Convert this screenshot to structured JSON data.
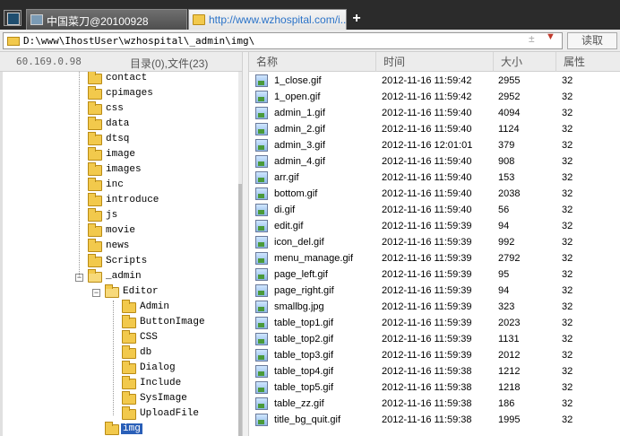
{
  "tabs": [
    {
      "label": "中国菜刀@20100928"
    },
    {
      "label": "http://www.wzhospital.com/i..."
    }
  ],
  "new_tab_label": "+",
  "address": {
    "path": "D:\\www\\IhostUser\\wzhospital\\_admin\\img\\",
    "plus": "±",
    "read_label": "读取"
  },
  "left_header": {
    "ip": "60.169.0.98",
    "dir_count": "目录(0),文件(23)"
  },
  "columns": {
    "name": "名称",
    "time": "时间",
    "size": "大小",
    "attr": "属性"
  },
  "tree": [
    {
      "label": "contact"
    },
    {
      "label": "cpimages"
    },
    {
      "label": "css"
    },
    {
      "label": "data"
    },
    {
      "label": "dtsq"
    },
    {
      "label": "image"
    },
    {
      "label": "images"
    },
    {
      "label": "inc"
    },
    {
      "label": "introduce"
    },
    {
      "label": "js"
    },
    {
      "label": "movie"
    },
    {
      "label": "news"
    },
    {
      "label": "Scripts"
    },
    {
      "label": "_admin",
      "expander": "−"
    },
    {
      "label": "Editor",
      "expander": "−"
    },
    {
      "label": "Admin"
    },
    {
      "label": "ButtonImage"
    },
    {
      "label": "CSS"
    },
    {
      "label": "db"
    },
    {
      "label": "Dialog"
    },
    {
      "label": "Include"
    },
    {
      "label": "SysImage"
    },
    {
      "label": "UploadFile"
    },
    {
      "label": "img"
    }
  ],
  "files": [
    {
      "name": "1_close.gif",
      "time": "2012-11-16 11:59:42",
      "size": "2955",
      "attr": "32"
    },
    {
      "name": "1_open.gif",
      "time": "2012-11-16 11:59:42",
      "size": "2952",
      "attr": "32"
    },
    {
      "name": "admin_1.gif",
      "time": "2012-11-16 11:59:40",
      "size": "4094",
      "attr": "32"
    },
    {
      "name": "admin_2.gif",
      "time": "2012-11-16 11:59:40",
      "size": "1124",
      "attr": "32"
    },
    {
      "name": "admin_3.gif",
      "time": "2012-11-16 12:01:01",
      "size": "379",
      "attr": "32"
    },
    {
      "name": "admin_4.gif",
      "time": "2012-11-16 11:59:40",
      "size": "908",
      "attr": "32"
    },
    {
      "name": "arr.gif",
      "time": "2012-11-16 11:59:40",
      "size": "153",
      "attr": "32"
    },
    {
      "name": "bottom.gif",
      "time": "2012-11-16 11:59:40",
      "size": "2038",
      "attr": "32"
    },
    {
      "name": "di.gif",
      "time": "2012-11-16 11:59:40",
      "size": "56",
      "attr": "32"
    },
    {
      "name": "edit.gif",
      "time": "2012-11-16 11:59:39",
      "size": "94",
      "attr": "32"
    },
    {
      "name": "icon_del.gif",
      "time": "2012-11-16 11:59:39",
      "size": "992",
      "attr": "32"
    },
    {
      "name": "menu_manage.gif",
      "time": "2012-11-16 11:59:39",
      "size": "2792",
      "attr": "32"
    },
    {
      "name": "page_left.gif",
      "time": "2012-11-16 11:59:39",
      "size": "95",
      "attr": "32"
    },
    {
      "name": "page_right.gif",
      "time": "2012-11-16 11:59:39",
      "size": "94",
      "attr": "32"
    },
    {
      "name": "smallbg.jpg",
      "time": "2012-11-16 11:59:39",
      "size": "323",
      "attr": "32"
    },
    {
      "name": "table_top1.gif",
      "time": "2012-11-16 11:59:39",
      "size": "2023",
      "attr": "32"
    },
    {
      "name": "table_top2.gif",
      "time": "2012-11-16 11:59:39",
      "size": "1131",
      "attr": "32"
    },
    {
      "name": "table_top3.gif",
      "time": "2012-11-16 11:59:39",
      "size": "2012",
      "attr": "32"
    },
    {
      "name": "table_top4.gif",
      "time": "2012-11-16 11:59:38",
      "size": "1212",
      "attr": "32"
    },
    {
      "name": "table_top5.gif",
      "time": "2012-11-16 11:59:38",
      "size": "1218",
      "attr": "32"
    },
    {
      "name": "table_zz.gif",
      "time": "2012-11-16 11:59:38",
      "size": "186",
      "attr": "32"
    },
    {
      "name": "title_bg_quit.gif",
      "time": "2012-11-16 11:59:38",
      "size": "1995",
      "attr": "32"
    }
  ],
  "colors": {
    "tabbar": "#2b2b2b",
    "link": "#2b73c8",
    "selection": "#2a5fb8",
    "folder": "#f2c94c"
  }
}
